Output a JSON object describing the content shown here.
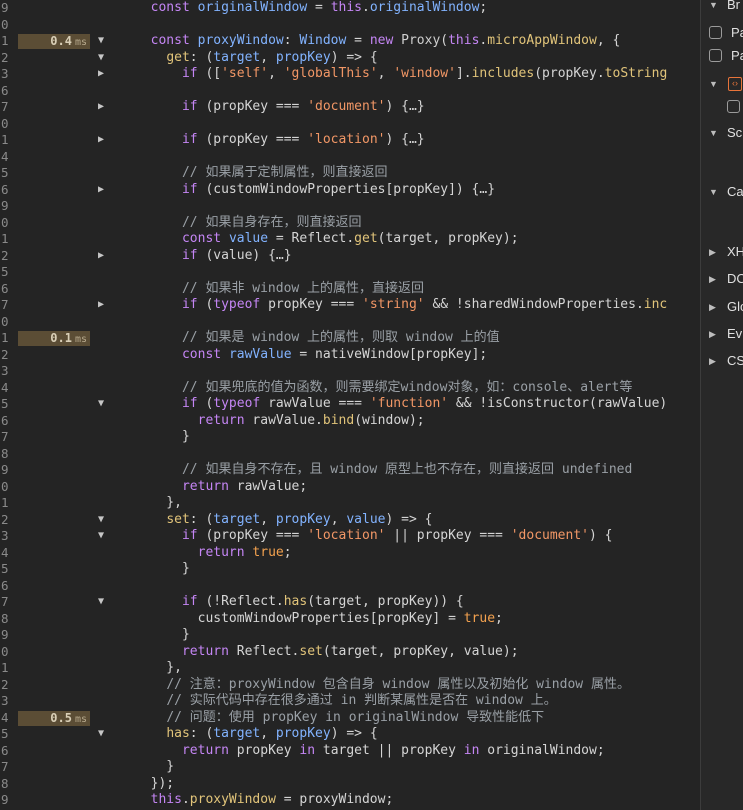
{
  "editor": {
    "lines": [
      {
        "ln": "9",
        "fold": "",
        "timing": null,
        "tokens": [
          [
            "",
            "  "
          ],
          [
            "kw",
            "const "
          ],
          [
            "pr",
            "originalWindow"
          ],
          [
            "",
            " = "
          ],
          [
            "kw",
            "this"
          ],
          [
            "",
            "."
          ],
          [
            "pr",
            "originalWindow"
          ],
          [
            "",
            ";"
          ]
        ]
      },
      {
        "ln": "0",
        "fold": "",
        "timing": null,
        "tokens": []
      },
      {
        "ln": "1",
        "fold": "down",
        "timing": {
          "num": "0.4",
          "unit": "ms"
        },
        "tokens": [
          [
            "",
            "  "
          ],
          [
            "kw",
            "const "
          ],
          [
            "pr",
            "proxyWindow"
          ],
          [
            "",
            ": "
          ],
          [
            "pr",
            "Window"
          ],
          [
            "",
            " = "
          ],
          [
            "kw",
            "new "
          ],
          [
            "cls",
            "Proxy"
          ],
          [
            "",
            "("
          ],
          [
            "kw",
            "this"
          ],
          [
            "",
            "."
          ],
          [
            "fn",
            "microAppWindow"
          ],
          [
            "",
            ", {"
          ]
        ]
      },
      {
        "ln": "2",
        "fold": "down",
        "timing": null,
        "tokens": [
          [
            "",
            "    "
          ],
          [
            "fn",
            "get"
          ],
          [
            "",
            ": ("
          ],
          [
            "pr",
            "target"
          ],
          [
            "",
            ", "
          ],
          [
            "pr",
            "propKey"
          ],
          [
            "",
            ") => {"
          ]
        ]
      },
      {
        "ln": "3",
        "fold": "right",
        "timing": null,
        "tokens": [
          [
            "",
            "      "
          ],
          [
            "kw",
            "if "
          ],
          [
            "",
            "(["
          ],
          [
            "str",
            "'self'"
          ],
          [
            "",
            ", "
          ],
          [
            "str",
            "'globalThis'"
          ],
          [
            "",
            ", "
          ],
          [
            "str",
            "'window'"
          ],
          [
            "",
            "]."
          ],
          [
            "fn",
            "includes"
          ],
          [
            "",
            "(propKey."
          ],
          [
            "fn",
            "toString"
          ]
        ]
      },
      {
        "ln": "6",
        "fold": "",
        "timing": null,
        "tokens": []
      },
      {
        "ln": "7",
        "fold": "right",
        "timing": null,
        "tokens": [
          [
            "",
            "      "
          ],
          [
            "kw",
            "if "
          ],
          [
            "",
            "(propKey === "
          ],
          [
            "str",
            "'document'"
          ],
          [
            "",
            ") {…}"
          ]
        ]
      },
      {
        "ln": "0",
        "fold": "",
        "timing": null,
        "tokens": []
      },
      {
        "ln": "1",
        "fold": "right",
        "timing": null,
        "tokens": [
          [
            "",
            "      "
          ],
          [
            "kw",
            "if "
          ],
          [
            "",
            "(propKey === "
          ],
          [
            "str",
            "'location'"
          ],
          [
            "",
            ") {…}"
          ]
        ]
      },
      {
        "ln": "4",
        "fold": "",
        "timing": null,
        "tokens": []
      },
      {
        "ln": "5",
        "fold": "",
        "timing": null,
        "tokens": [
          [
            "",
            "      "
          ],
          [
            "cm",
            "// 如果属于定制属性，则直接返回"
          ]
        ]
      },
      {
        "ln": "6",
        "fold": "right",
        "timing": null,
        "tokens": [
          [
            "",
            "      "
          ],
          [
            "kw",
            "if "
          ],
          [
            "",
            "(customWindowProperties[propKey]) {…}"
          ]
        ]
      },
      {
        "ln": "9",
        "fold": "",
        "timing": null,
        "tokens": []
      },
      {
        "ln": "0",
        "fold": "",
        "timing": null,
        "tokens": [
          [
            "",
            "      "
          ],
          [
            "cm",
            "// 如果自身存在，则直接返回"
          ]
        ]
      },
      {
        "ln": "1",
        "fold": "",
        "timing": null,
        "tokens": [
          [
            "",
            "      "
          ],
          [
            "kw",
            "const "
          ],
          [
            "pr",
            "value"
          ],
          [
            "",
            " = Reflect."
          ],
          [
            "fn",
            "get"
          ],
          [
            "",
            "(target, propKey);"
          ]
        ]
      },
      {
        "ln": "2",
        "fold": "right",
        "timing": null,
        "tokens": [
          [
            "",
            "      "
          ],
          [
            "kw",
            "if "
          ],
          [
            "",
            "(value) {…}"
          ]
        ]
      },
      {
        "ln": "5",
        "fold": "",
        "timing": null,
        "tokens": []
      },
      {
        "ln": "6",
        "fold": "",
        "timing": null,
        "tokens": [
          [
            "",
            "      "
          ],
          [
            "cm",
            "// 如果非 window 上的属性，直接返回"
          ]
        ]
      },
      {
        "ln": "7",
        "fold": "right",
        "timing": null,
        "tokens": [
          [
            "",
            "      "
          ],
          [
            "kw",
            "if "
          ],
          [
            "",
            "("
          ],
          [
            "kw",
            "typeof "
          ],
          [
            "",
            "propKey === "
          ],
          [
            "str",
            "'string'"
          ],
          [
            "",
            " && !sharedWindowProperties."
          ],
          [
            "fn",
            "inc"
          ]
        ]
      },
      {
        "ln": "0",
        "fold": "",
        "timing": null,
        "tokens": []
      },
      {
        "ln": "1",
        "fold": "",
        "timing": {
          "num": "0.1",
          "unit": "ms"
        },
        "tokens": [
          [
            "",
            "      "
          ],
          [
            "cm",
            "// 如果是 window 上的属性，则取 window 上的值"
          ]
        ]
      },
      {
        "ln": "2",
        "fold": "",
        "timing": null,
        "tokens": [
          [
            "",
            "      "
          ],
          [
            "kw",
            "const "
          ],
          [
            "pr",
            "rawValue"
          ],
          [
            "",
            " = nativeWindow[propKey];"
          ]
        ]
      },
      {
        "ln": "3",
        "fold": "",
        "timing": null,
        "tokens": []
      },
      {
        "ln": "4",
        "fold": "",
        "timing": null,
        "tokens": [
          [
            "",
            "      "
          ],
          [
            "cm",
            "// 如果兜底的值为函数，则需要绑定window对象，如：console、alert等"
          ]
        ]
      },
      {
        "ln": "5",
        "fold": "down",
        "timing": null,
        "tokens": [
          [
            "",
            "      "
          ],
          [
            "kw",
            "if "
          ],
          [
            "",
            "("
          ],
          [
            "kw",
            "typeof "
          ],
          [
            "",
            "rawValue === "
          ],
          [
            "str",
            "'function'"
          ],
          [
            "",
            " && !isConstructor(rawValue)"
          ]
        ]
      },
      {
        "ln": "6",
        "fold": "",
        "timing": null,
        "tokens": [
          [
            "",
            "        "
          ],
          [
            "kw",
            "return "
          ],
          [
            "",
            "rawValue."
          ],
          [
            "fn",
            "bind"
          ],
          [
            "",
            "(window);"
          ]
        ]
      },
      {
        "ln": "7",
        "fold": "",
        "timing": null,
        "tokens": [
          [
            "",
            "      }"
          ]
        ]
      },
      {
        "ln": "8",
        "fold": "",
        "timing": null,
        "tokens": []
      },
      {
        "ln": "9",
        "fold": "",
        "timing": null,
        "tokens": [
          [
            "",
            "      "
          ],
          [
            "cm",
            "// 如果自身不存在，且 window 原型上也不存在，则直接返回 undefined"
          ]
        ]
      },
      {
        "ln": "0",
        "fold": "",
        "timing": null,
        "tokens": [
          [
            "",
            "      "
          ],
          [
            "kw",
            "return "
          ],
          [
            "",
            "rawValue;"
          ]
        ]
      },
      {
        "ln": "1",
        "fold": "",
        "timing": null,
        "tokens": [
          [
            "",
            "    },"
          ]
        ]
      },
      {
        "ln": "2",
        "fold": "down",
        "timing": null,
        "tokens": [
          [
            "",
            "    "
          ],
          [
            "fn",
            "set"
          ],
          [
            "",
            ": ("
          ],
          [
            "pr",
            "target"
          ],
          [
            "",
            ", "
          ],
          [
            "pr",
            "propKey"
          ],
          [
            "",
            ", "
          ],
          [
            "pr",
            "value"
          ],
          [
            "",
            ") => {"
          ]
        ]
      },
      {
        "ln": "3",
        "fold": "down",
        "timing": null,
        "tokens": [
          [
            "",
            "      "
          ],
          [
            "kw",
            "if "
          ],
          [
            "",
            "(propKey === "
          ],
          [
            "str",
            "'location'"
          ],
          [
            "",
            " || propKey === "
          ],
          [
            "str",
            "'document'"
          ],
          [
            "",
            ") {"
          ]
        ]
      },
      {
        "ln": "4",
        "fold": "",
        "timing": null,
        "tokens": [
          [
            "",
            "        "
          ],
          [
            "kw",
            "return "
          ],
          [
            "tr",
            "true"
          ],
          [
            "",
            ";"
          ]
        ]
      },
      {
        "ln": "5",
        "fold": "",
        "timing": null,
        "tokens": [
          [
            "",
            "      }"
          ]
        ]
      },
      {
        "ln": "6",
        "fold": "",
        "timing": null,
        "tokens": []
      },
      {
        "ln": "7",
        "fold": "down",
        "timing": null,
        "tokens": [
          [
            "",
            "      "
          ],
          [
            "kw",
            "if "
          ],
          [
            "",
            "(!Reflect."
          ],
          [
            "fn",
            "has"
          ],
          [
            "",
            "(target, propKey)) {"
          ]
        ]
      },
      {
        "ln": "8",
        "fold": "",
        "timing": null,
        "tokens": [
          [
            "",
            "        customWindowProperties[propKey] = "
          ],
          [
            "tr",
            "true"
          ],
          [
            "",
            ";"
          ]
        ]
      },
      {
        "ln": "9",
        "fold": "",
        "timing": null,
        "tokens": [
          [
            "",
            "      }"
          ]
        ]
      },
      {
        "ln": "0",
        "fold": "",
        "timing": null,
        "tokens": [
          [
            "",
            "      "
          ],
          [
            "kw",
            "return "
          ],
          [
            "",
            "Reflect."
          ],
          [
            "fn",
            "set"
          ],
          [
            "",
            "(target, propKey, value);"
          ]
        ]
      },
      {
        "ln": "1",
        "fold": "",
        "timing": null,
        "tokens": [
          [
            "",
            "    },"
          ]
        ]
      },
      {
        "ln": "2",
        "fold": "",
        "timing": null,
        "tokens": [
          [
            "",
            "    "
          ],
          [
            "cm",
            "// 注意：proxyWindow 包含自身 window 属性以及初始化 window 属性。"
          ]
        ]
      },
      {
        "ln": "3",
        "fold": "",
        "timing": null,
        "tokens": [
          [
            "",
            "    "
          ],
          [
            "cm",
            "// 实际代码中存在很多通过 in 判断某属性是否在 window 上。"
          ]
        ]
      },
      {
        "ln": "4",
        "fold": "",
        "timing": {
          "num": "0.5",
          "unit": "ms"
        },
        "tokens": [
          [
            "",
            "    "
          ],
          [
            "cm",
            "// 问题：使用 propKey in originalWindow 导致性能低下"
          ]
        ]
      },
      {
        "ln": "5",
        "fold": "down",
        "timing": null,
        "tokens": [
          [
            "",
            "    "
          ],
          [
            "fn",
            "has"
          ],
          [
            "",
            ": ("
          ],
          [
            "pr",
            "target"
          ],
          [
            "",
            ", "
          ],
          [
            "pr",
            "propKey"
          ],
          [
            "",
            ") => {"
          ]
        ]
      },
      {
        "ln": "6",
        "fold": "",
        "timing": null,
        "tokens": [
          [
            "",
            "      "
          ],
          [
            "kw",
            "return "
          ],
          [
            "",
            "propKey "
          ],
          [
            "kw",
            "in "
          ],
          [
            "",
            "target || propKey "
          ],
          [
            "kw",
            "in "
          ],
          [
            "",
            "originalWindow;"
          ]
        ]
      },
      {
        "ln": "7",
        "fold": "",
        "timing": null,
        "tokens": [
          [
            "",
            "    }"
          ]
        ]
      },
      {
        "ln": "8",
        "fold": "",
        "timing": null,
        "tokens": [
          [
            "",
            "  });"
          ]
        ]
      },
      {
        "ln": "9",
        "fold": "",
        "timing": null,
        "tokens": [
          [
            "",
            "  "
          ],
          [
            "kw",
            "this"
          ],
          [
            "",
            "."
          ],
          [
            "fn",
            "proxyWindow"
          ],
          [
            "",
            " = proxyWindow;"
          ]
        ]
      }
    ]
  },
  "sidepanel": {
    "rows": [
      {
        "type": "section",
        "label": "Br",
        "open": true
      },
      {
        "type": "checkbox",
        "label": "Pa"
      },
      {
        "type": "checkbox",
        "label": "Pa"
      },
      {
        "type": "section-icon",
        "label": "",
        "open": true,
        "icon": "code-bracket-icon"
      },
      {
        "type": "checkbox-only",
        "label": ""
      },
      {
        "type": "section",
        "label": "Sc",
        "open": true
      },
      {
        "type": "blank",
        "label": ""
      },
      {
        "type": "section",
        "label": "Ca",
        "open": true
      },
      {
        "type": "blank",
        "label": ""
      },
      {
        "type": "section",
        "label": "XH",
        "open": false
      },
      {
        "type": "section",
        "label": "DC",
        "open": false
      },
      {
        "type": "section",
        "label": "Glo",
        "open": false
      },
      {
        "type": "section",
        "label": "Ev",
        "open": false
      },
      {
        "type": "section",
        "label": "CS",
        "open": false
      }
    ]
  },
  "colors": {
    "background": "#242424",
    "timing_badge": "#5b4d35",
    "keyword": "#c586f5",
    "property": "#82b3ff",
    "function": "#e1c47a",
    "string": "#f29766",
    "comment": "#9aa0a6"
  }
}
